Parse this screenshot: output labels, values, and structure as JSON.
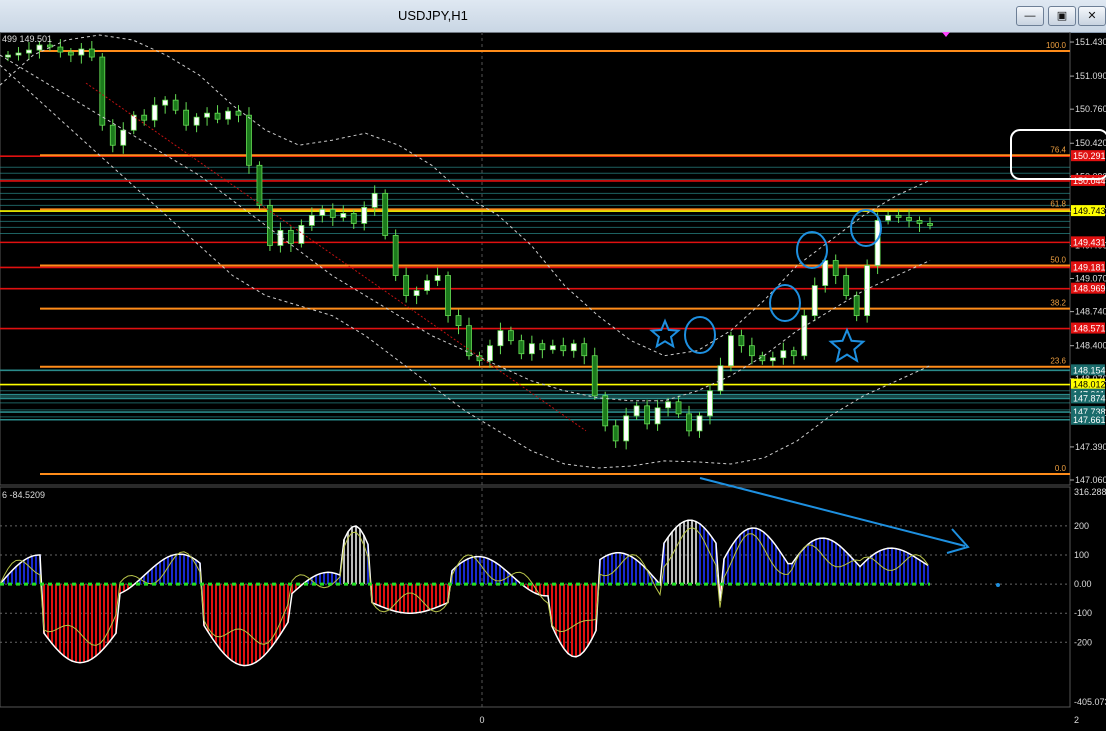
{
  "window": {
    "title": "USDJPY,H1",
    "minimize_label": "—",
    "restore_label": "▣",
    "close_label": "✕"
  },
  "main": {
    "header_text": "499 149.501",
    "price_axis": [
      "151.430",
      "151.090",
      "150.760",
      "150.420",
      "150.090",
      "149.740",
      "149.400",
      "149.070",
      "148.740",
      "148.400",
      "148.070",
      "147.730",
      "147.390",
      "147.060"
    ],
    "fib_levels": [
      {
        "label": "100.0",
        "price": 151.34
      },
      {
        "label": "76.4",
        "price": 150.3
      },
      {
        "label": "61.8",
        "price": 149.76
      },
      {
        "label": "50.0",
        "price": 149.2
      },
      {
        "label": "38.2",
        "price": 148.77
      },
      {
        "label": "23.6",
        "price": 148.19
      },
      {
        "label": "0.0",
        "price": 147.12
      }
    ],
    "price_tags": [
      {
        "text": "150.291",
        "price": 150.291,
        "color": "#e01010"
      },
      {
        "text": "150.044",
        "price": 150.044,
        "color": "#e01010"
      },
      {
        "text": "149.743",
        "price": 149.743,
        "color": "#ffff00"
      },
      {
        "text": "149.431",
        "price": 149.431,
        "color": "#e01010"
      },
      {
        "text": "149.181",
        "price": 149.181,
        "color": "#e01010"
      },
      {
        "text": "148.969",
        "price": 148.969,
        "color": "#e01010"
      },
      {
        "text": "148.571",
        "price": 148.571,
        "color": "#e01010"
      },
      {
        "text": "148.154",
        "price": 148.154,
        "color": "#1a6b6b"
      },
      {
        "text": "148.012",
        "price": 148.012,
        "color": "#ffff00"
      },
      {
        "text": "147.911",
        "price": 147.911,
        "color": "#1a6b6b"
      },
      {
        "text": "147.874",
        "price": 147.874,
        "color": "#1a6b6b"
      },
      {
        "text": "147.738",
        "price": 147.738,
        "color": "#1a6b6b"
      },
      {
        "text": "147.661",
        "price": 147.661,
        "color": "#1a6b6b"
      }
    ]
  },
  "oscillator": {
    "header_text": "6 -84.5209",
    "axis": [
      "316.288",
      "200",
      "100",
      "0.00",
      "-100",
      "-200",
      "-405.073"
    ],
    "time_label": "0",
    "corner_label": "2"
  },
  "colors": {
    "background": "#000000",
    "bull_candle": "#ffffff",
    "bear_candle": "#1c7a1c",
    "candle_wick": "#66dd55",
    "fib_line": "#ff8c1a",
    "resistance_red": "#e01010",
    "annotation_blue": "#1e90e0"
  }
}
